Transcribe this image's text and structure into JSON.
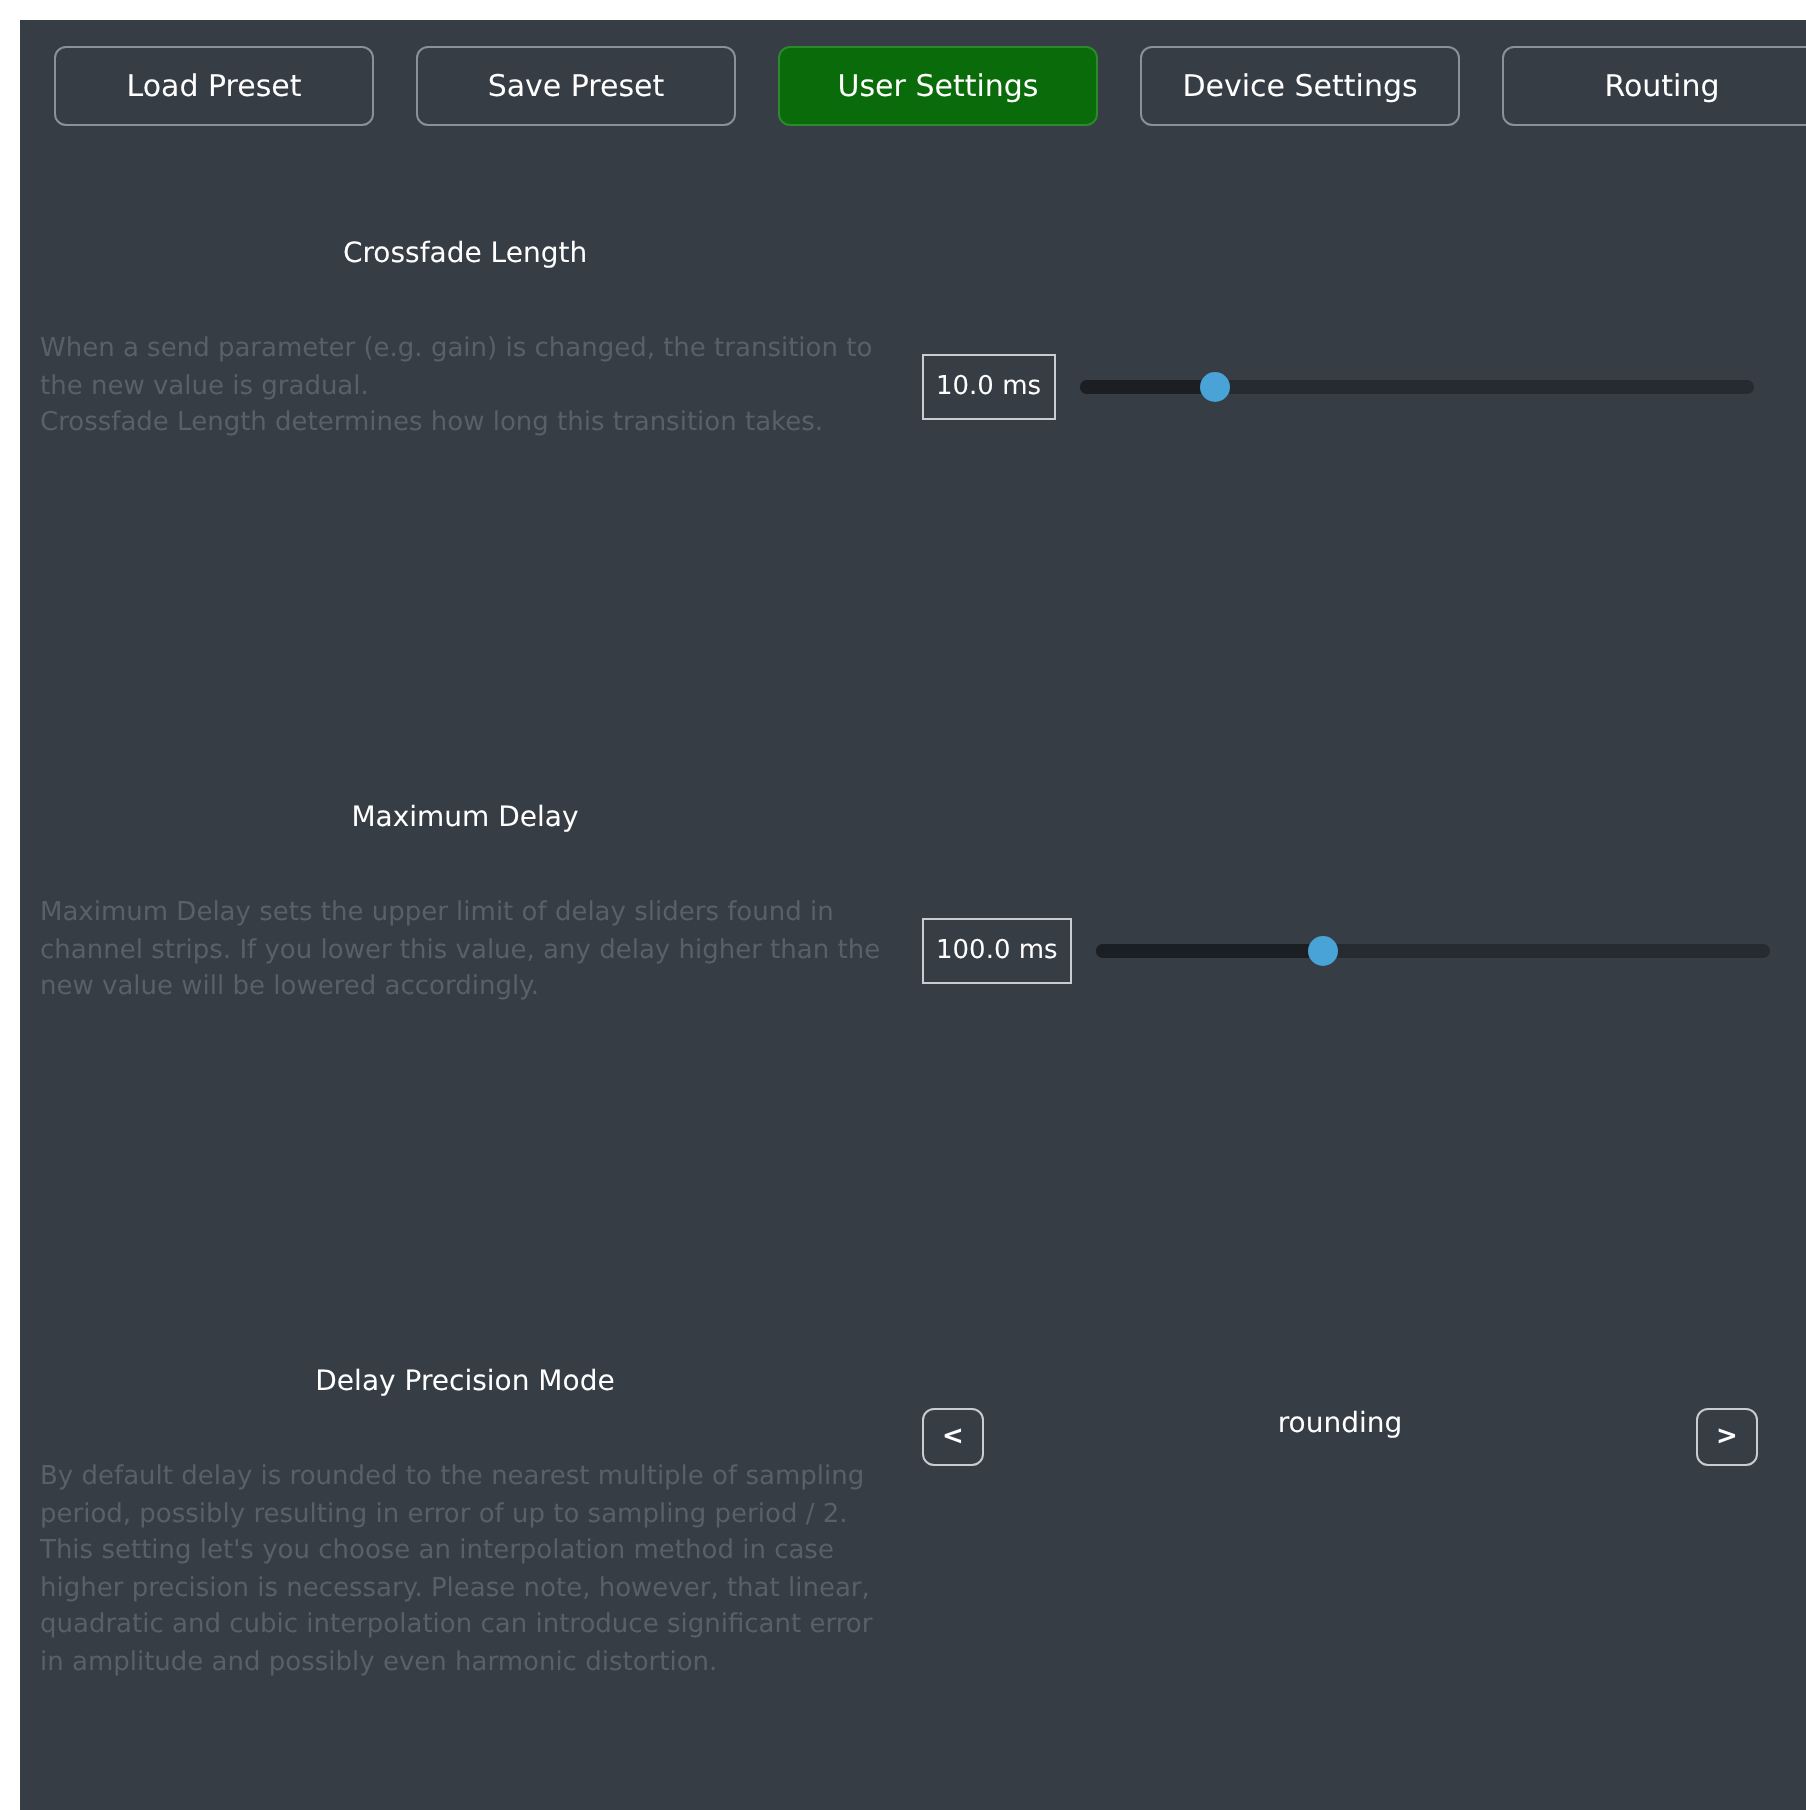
{
  "tabs": [
    {
      "label": "Load Preset",
      "selected": false
    },
    {
      "label": "Save Preset",
      "selected": false
    },
    {
      "label": "User Settings",
      "selected": true
    },
    {
      "label": "Device Settings",
      "selected": false
    },
    {
      "label": "Routing",
      "selected": false
    }
  ],
  "settings": [
    {
      "kind": "slider",
      "title": "Crossfade Length",
      "description": "When a send parameter (e.g. gain) is changed, the transition to the new value is gradual.\nCrossfade Length determines how long this transition takes.",
      "value": "10.0 ms",
      "level": 0.2
    },
    {
      "kind": "slider",
      "title": "Maximum Delay",
      "description": "Maximum Delay sets the upper limit of delay sliders found in channel strips. If you lower this value, any delay higher than the new value will be lowered accordingly.",
      "value": "100.0 ms",
      "level": 0.335
    },
    {
      "kind": "stepper",
      "title": "Delay Precision Mode",
      "description": "By default delay is rounded to the nearest multiple of sampling period, possibly resulting in error of up to sampling period / 2.\nThis setting let's you choose an interpolation method in case higher precision is necessary. Please note, however, that linear, quadratic and cubic interpolation can introduce significant error in amplitude and possibly even harmonic distortion.",
      "value": "rounding",
      "prev": "<",
      "next": ">"
    }
  ]
}
